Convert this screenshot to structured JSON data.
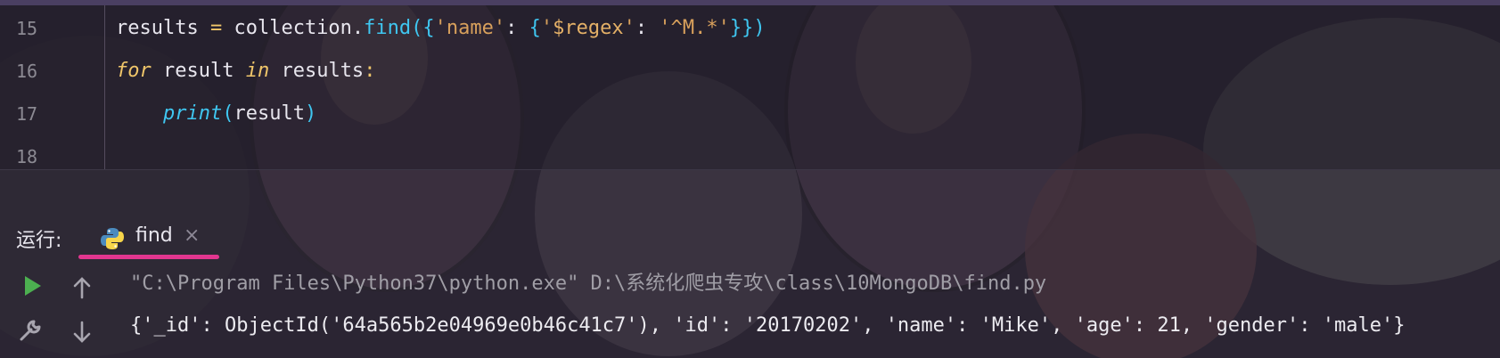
{
  "editor": {
    "lines": [
      {
        "number": "15",
        "code": "results = collection.find({'name': {'$regex': '^M.*'}})"
      },
      {
        "number": "16",
        "code": "for result in results:"
      },
      {
        "number": "17",
        "code": "    print(result)"
      },
      {
        "number": "18",
        "code": ""
      }
    ]
  },
  "run_panel": {
    "label": "运行:",
    "tab": {
      "title": "find",
      "icon": "python-icon",
      "close": "×"
    },
    "toolbar": [
      "run-icon",
      "scroll-up-icon",
      "wrench-icon",
      "scroll-down-icon"
    ],
    "output": {
      "command": "\"C:\\Program Files\\Python37\\python.exe\" D:\\系统化爬虫专攻\\class\\10MongoDB\\find.py",
      "result": "{'_id': ObjectId('64a565b2e04969e0b46c41c7'), 'id': '20170202', 'name': 'Mike', 'age': 21, 'gender': 'male'}"
    }
  },
  "colors": {
    "accent": "#e2368f",
    "run_green": "#4caf50",
    "keyword": "#f0c66a",
    "function": "#3fc6f0",
    "string": "#d8a05c"
  }
}
